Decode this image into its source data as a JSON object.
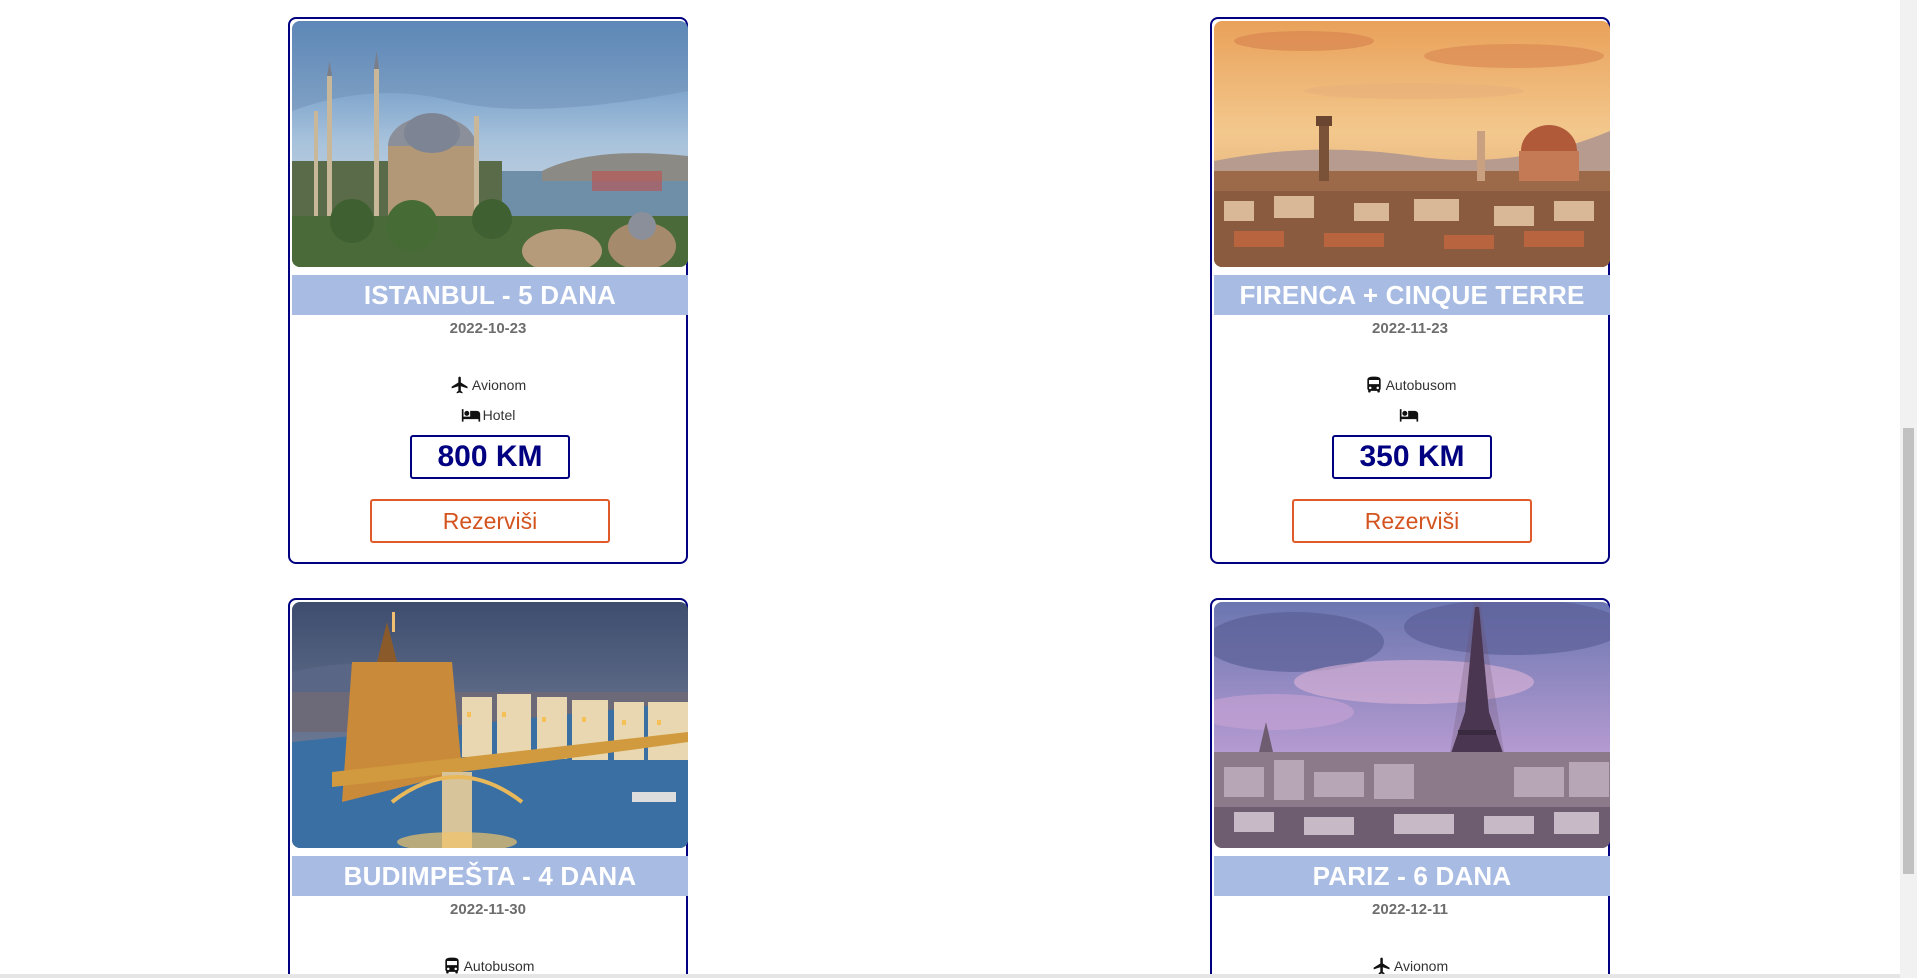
{
  "tours": [
    {
      "title": "ISTANBUL - 5 DANA",
      "date": "2022-10-23",
      "transport": {
        "label": "Avionom",
        "icon": "airplane-icon"
      },
      "lodging": {
        "label": "Hotel",
        "icon": "bed-icon"
      },
      "price": "800 KM",
      "reserve_label": "Rezerviši",
      "image": "istanbul-skyline-photo"
    },
    {
      "title": "FIRENCA + CINQUE TERRE",
      "date": "2022-11-23",
      "transport": {
        "label": "Autobusom",
        "icon": "bus-icon"
      },
      "lodging": {
        "label": "",
        "icon": "bed-icon"
      },
      "price": "350 KM",
      "reserve_label": "Rezerviši",
      "image": "florence-sunset-photo"
    },
    {
      "title": "BUDIMPEŠTA - 4 DANA",
      "date": "2022-11-30",
      "transport": {
        "label": "Autobusom",
        "icon": "bus-icon"
      },
      "image": "budapest-night-photo"
    },
    {
      "title": "PARIZ - 6 DANA",
      "date": "2022-12-11",
      "transport": {
        "label": "Avionom",
        "icon": "airplane-icon"
      },
      "image": "paris-eiffel-photo"
    }
  ],
  "colors": {
    "card_border": "#000080",
    "title_band": "#a8bbe3",
    "price_text": "#000080",
    "reserve_button": "#e05a2a"
  }
}
